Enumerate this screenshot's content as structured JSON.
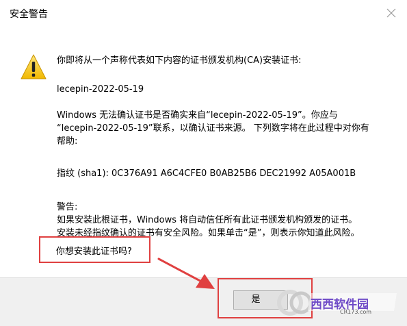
{
  "window": {
    "title": "安全警告",
    "close_icon": "close-icon"
  },
  "warning_icon": "warning-icon",
  "body": {
    "intro": "你即将从一个声称代表如下内容的证书颁发机构(CA)安装证书:",
    "cert_name": "lecepin-2022-05-19",
    "cannot_verify_lines": [
      "Windows 无法确认证书是否确实来自“lecepin-2022-05-19”。你应与",
      "“lecepin-2022-05-19”联系，以确认证书来源。 下列数字将在此过程中对你有",
      "帮助:"
    ],
    "thumbprint": "指纹 (sha1): 0C376A91 A6C4CFE0 B0AB25B6 DEC21992 A05A001B",
    "warning_heading": "警告:",
    "warning_lines": [
      "如果安装此根证书，Windows 将自动信任所有此证书颁发机构颁发的证书。",
      "安装未经指纹确认的证书有安全风险。如果单击“是”，则表示你知道此风险。"
    ]
  },
  "question": "你想安装此证书吗?",
  "buttons": {
    "yes_label": "是"
  },
  "watermark": {
    "text": "西西软件园",
    "url": "CR173.com"
  },
  "colors": {
    "annotation_red": "#e04040",
    "footer_bg": "#f0f0f0",
    "warning_yellow": "#f5c518"
  }
}
